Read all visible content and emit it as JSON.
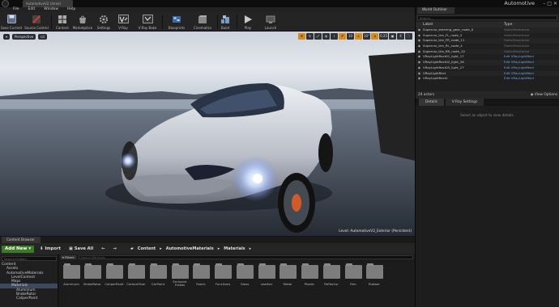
{
  "window": {
    "tab_label": "AutomotiveV2 Unreal",
    "project_name": "Automotive",
    "controls": [
      "–",
      "□",
      "✕"
    ]
  },
  "menu": [
    "File",
    "Edit",
    "Window",
    "Help"
  ],
  "toolbar": [
    {
      "label": "Save Current",
      "icon": "save-icon"
    },
    {
      "label": "Source Control",
      "icon": "source-control-icon"
    },
    {
      "label": "Content",
      "icon": "content-icon"
    },
    {
      "label": "Marketplace",
      "icon": "marketplace-icon"
    },
    {
      "label": "Settings",
      "icon": "settings-icon"
    },
    {
      "label": "V-Ray",
      "icon": "vray-icon"
    },
    {
      "label": "V-Ray Bake",
      "icon": "vray-bake-icon"
    },
    {
      "label": "Blueprints",
      "icon": "blueprint-icon"
    },
    {
      "label": "Cinematics",
      "icon": "cinematics-icon"
    },
    {
      "label": "Build",
      "icon": "build-icon"
    },
    {
      "label": "Play",
      "icon": "play-icon"
    },
    {
      "label": "Launch",
      "icon": "launch-icon"
    }
  ],
  "viewport": {
    "perspective_label": "Perspective",
    "lit_label": "Lit",
    "snap_angle": "10°",
    "snap_scale": "0.25",
    "camera_speed": "4",
    "level_label": "Level: AutomotiveV2_Exterior (Persistent)"
  },
  "outliner": {
    "tab_label": "World Outliner",
    "search_placeholder": "Search...",
    "col_label": "Label",
    "col_type": "Type",
    "rows": [
      {
        "label": "Supercar_steering_gear_node_0",
        "type": "StaticMeshActor",
        "link": false
      },
      {
        "label": "Supercar_tire_FL_node_3",
        "type": "StaticMeshActor",
        "link": false
      },
      {
        "label": "Supercar_tire_FR_node_11",
        "type": "StaticMeshActor",
        "link": false
      },
      {
        "label": "Supercar_tire_RL_node_4",
        "type": "StaticMeshActor",
        "link": false
      },
      {
        "label": "Supercar_tire_RR_node_10",
        "type": "StaticMeshActor",
        "link": false
      },
      {
        "label": "VRayLightRect01_light_17",
        "type": "Edit VRayLightRect",
        "link": true
      },
      {
        "label": "VRayLightRect02_light_26",
        "type": "Edit VRayLightRect",
        "link": true
      },
      {
        "label": "VRayLightRect03_light_27",
        "type": "Edit VRayLightRect",
        "link": true
      },
      {
        "label": "VRayLightRect",
        "type": "Edit VRayLightRect",
        "link": true
      },
      {
        "label": "VRayLightRect2",
        "type": "Edit VRayLightRect",
        "link": true
      }
    ],
    "actor_count": "24 actors",
    "view_options": "View Options"
  },
  "details": {
    "tabs": [
      "Details",
      "V-Ray Settings"
    ],
    "empty_text": "Select an object to view details."
  },
  "content_browser": {
    "tab_label": "Content Browser",
    "add_new": "Add New",
    "import": "Import",
    "save_all": "Save All",
    "breadcrumb": [
      "Content",
      "AutomotiveMaterials",
      "Materials"
    ],
    "folder_search_placeholder": "Search Folders",
    "asset_search_placeholder": "Search Materials",
    "filters_label": "Filters",
    "tree": [
      "Content",
      "Assets",
      "AutomotiveMaterials",
      "LevelContent",
      "Maps",
      "Materials",
      "Aluminium",
      "BrakeRotor",
      "CaliperPaint"
    ],
    "folders": [
      "Aluminum",
      "BrakeRotor",
      "CaliperPaint",
      "CarbonFiber",
      "CarPaint",
      "Emissive Flakes",
      "Fabric",
      "Functions",
      "Glass",
      "Leather",
      "Metal",
      "Plastic",
      "Reflector",
      "Rim",
      "Rubber"
    ]
  },
  "colors": {
    "accent": "#d98c15",
    "add_new": "#3d7a26",
    "link": "#6fa5e6"
  }
}
